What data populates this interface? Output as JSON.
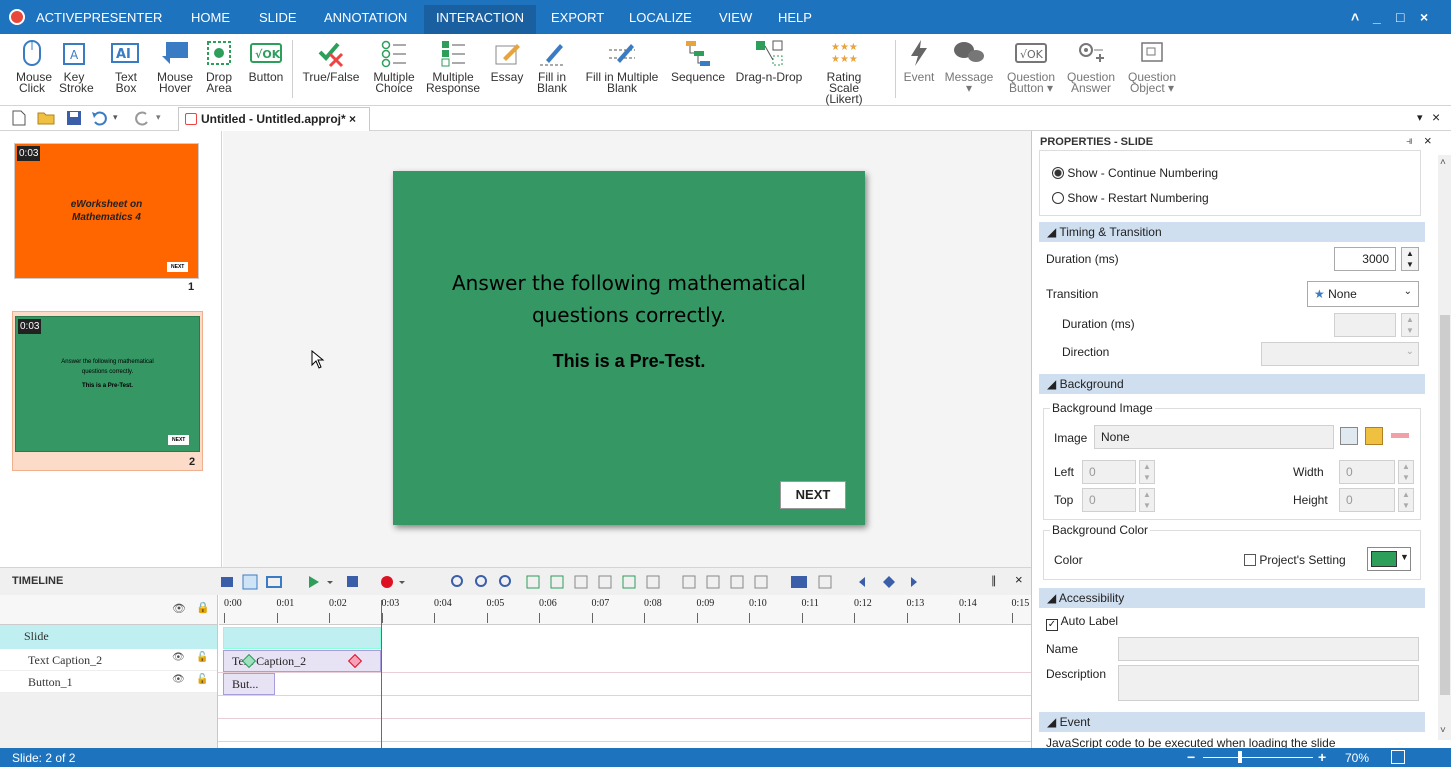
{
  "app": {
    "name": "ACTIVEPRESENTER"
  },
  "menu": {
    "tabs": [
      "HOME",
      "SLIDE",
      "ANNOTATION",
      "INTERACTION",
      "EXPORT",
      "LOCALIZE",
      "VIEW",
      "HELP"
    ],
    "active": "INTERACTION"
  },
  "window_controls": {
    "collapse": "˄",
    "minimize": "_",
    "restore": "□",
    "close": "×"
  },
  "ribbon": {
    "mouse_click": [
      "Mouse",
      "Click"
    ],
    "key_stroke": [
      "Key",
      "Stroke"
    ],
    "text_box": [
      "Text",
      "Box"
    ],
    "mouse_hover": [
      "Mouse",
      "Hover"
    ],
    "drop_area": [
      "Drop",
      "Area"
    ],
    "button": [
      "Button",
      ""
    ],
    "true_false": [
      "True/False",
      ""
    ],
    "multiple_choice": [
      "Multiple",
      "Choice"
    ],
    "multiple_response": [
      "Multiple",
      "Response"
    ],
    "essay": [
      "Essay",
      ""
    ],
    "fill_blank": [
      "Fill in",
      "Blank"
    ],
    "fill_multiple": [
      "Fill in Multiple",
      "Blank"
    ],
    "sequence": [
      "Sequence",
      ""
    ],
    "drag_drop": [
      "Drag-n-Drop",
      ""
    ],
    "rating_scale": [
      "Rating Scale",
      "(Likert)"
    ],
    "event": [
      "Event",
      ""
    ],
    "message": [
      "Message",
      "▾"
    ],
    "question_button": [
      "Question",
      "Button ▾"
    ],
    "question_answer": [
      "Question",
      "Answer"
    ],
    "question_object": [
      "Question",
      "Object ▾"
    ]
  },
  "document_tab": {
    "title": "Untitled - Untitled.approj*",
    "close": "×"
  },
  "slides": [
    {
      "duration": "0:03",
      "title_lines": [
        "eWorksheet on",
        "Mathematics 4"
      ],
      "next": "NEXT",
      "number": "1",
      "color": "#ff6600"
    },
    {
      "duration": "0:03",
      "title_lines": [
        "Answer the following mathematical",
        "questions correctly."
      ],
      "subtitle": "This is a Pre-Test.",
      "next": "NEXT",
      "number": "2",
      "color": "#349764"
    }
  ],
  "canvas": {
    "line1": "Answer the following mathematical",
    "line2": "questions correctly.",
    "subtitle": "This is a Pre-Test.",
    "next": "NEXT"
  },
  "timeline": {
    "title": "TIMELINE",
    "ticks": [
      "0:00",
      "0:01",
      "0:02",
      "0:03",
      "0:04",
      "0:05",
      "0:06",
      "0:07",
      "0:08",
      "0:09",
      "0:10",
      "0:11",
      "0:12",
      "0:13",
      "0:14",
      "0:15"
    ],
    "rows": [
      "Slide",
      "Text Caption_2",
      "Button_1"
    ],
    "clips": {
      "text_caption": "Text Caption_2",
      "button": "But..."
    },
    "pin": "∥",
    "close": "×"
  },
  "properties": {
    "title": "PROPERTIES - SLIDE",
    "numbering": [
      "Show - Continue Numbering",
      "Show - Restart Numbering"
    ],
    "sections": {
      "timing": "Timing & Transition",
      "background": "Background",
      "accessibility": "Accessibility",
      "event": "Event"
    },
    "duration_label": "Duration (ms)",
    "duration_value": "3000",
    "transition_label": "Transition",
    "transition_value": "None",
    "trans_duration_label": "Duration (ms)",
    "direction_label": "Direction",
    "bg_image_group": "Background Image",
    "image_label": "Image",
    "image_value": "None",
    "left_label": "Left",
    "left_value": "0",
    "top_label": "Top",
    "top_value": "0",
    "width_label": "Width",
    "width_value": "0",
    "height_label": "Height",
    "height_value": "0",
    "bg_color_group": "Background Color",
    "color_label": "Color",
    "project_setting": "Project's Setting",
    "bg_color": "#2e9e5b",
    "auto_label": "Auto Label",
    "name_label": "Name",
    "description_label": "Description",
    "event_text": "JavaScript code to be executed when loading the slide"
  },
  "status": {
    "slide": "Slide: 2 of 2",
    "zoom": "70%"
  }
}
